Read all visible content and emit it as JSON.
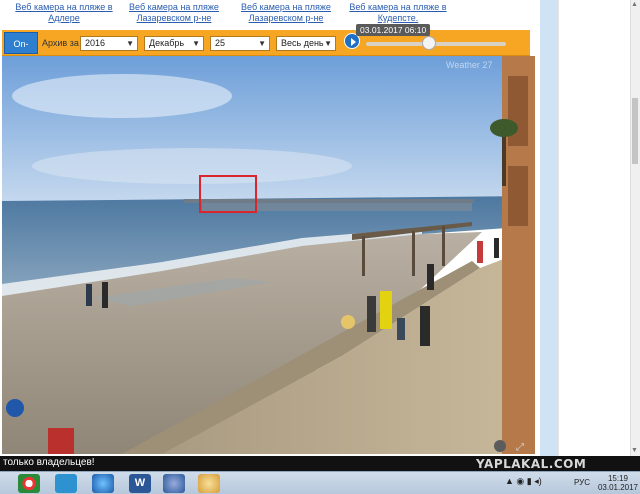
{
  "top_links": [
    {
      "label": "Веб камера на пляже в Адлере"
    },
    {
      "label": "Веб камера на пляже Лазаревском р-не"
    },
    {
      "label": "Веб камера на пляже Лазаревском р-не"
    },
    {
      "label": "Веб камера на пляже в Кудепсте."
    }
  ],
  "toolbar": {
    "online_label": "On-Line",
    "archive_label": "Архив за",
    "year": "2016",
    "month": "Декабрь",
    "day": "25",
    "period": "Весь день",
    "timestamp": "03.01.2017 06:10",
    "slider_position": 0.45
  },
  "camera": {
    "overlay_label": "Weather 27"
  },
  "banner": {
    "text": "только владельцев!",
    "watermark": "YAPLAKAL.COM"
  },
  "taskbar": {
    "apps": [
      "chrome-icon",
      "paint-icon",
      "globe-icon",
      "word-icon",
      "earth-icon",
      "palette-icon"
    ],
    "tray_icons": "▲ ◉ ▮ ◂)",
    "language": "РУС",
    "time": "15:19",
    "date": "03.01.2017"
  },
  "colors": {
    "toolbar": "#f6a623",
    "online": "#2f7fd1",
    "highlight_box": "#d9262c",
    "sky": "#8fb7e3",
    "sea": "#5f86a9"
  }
}
